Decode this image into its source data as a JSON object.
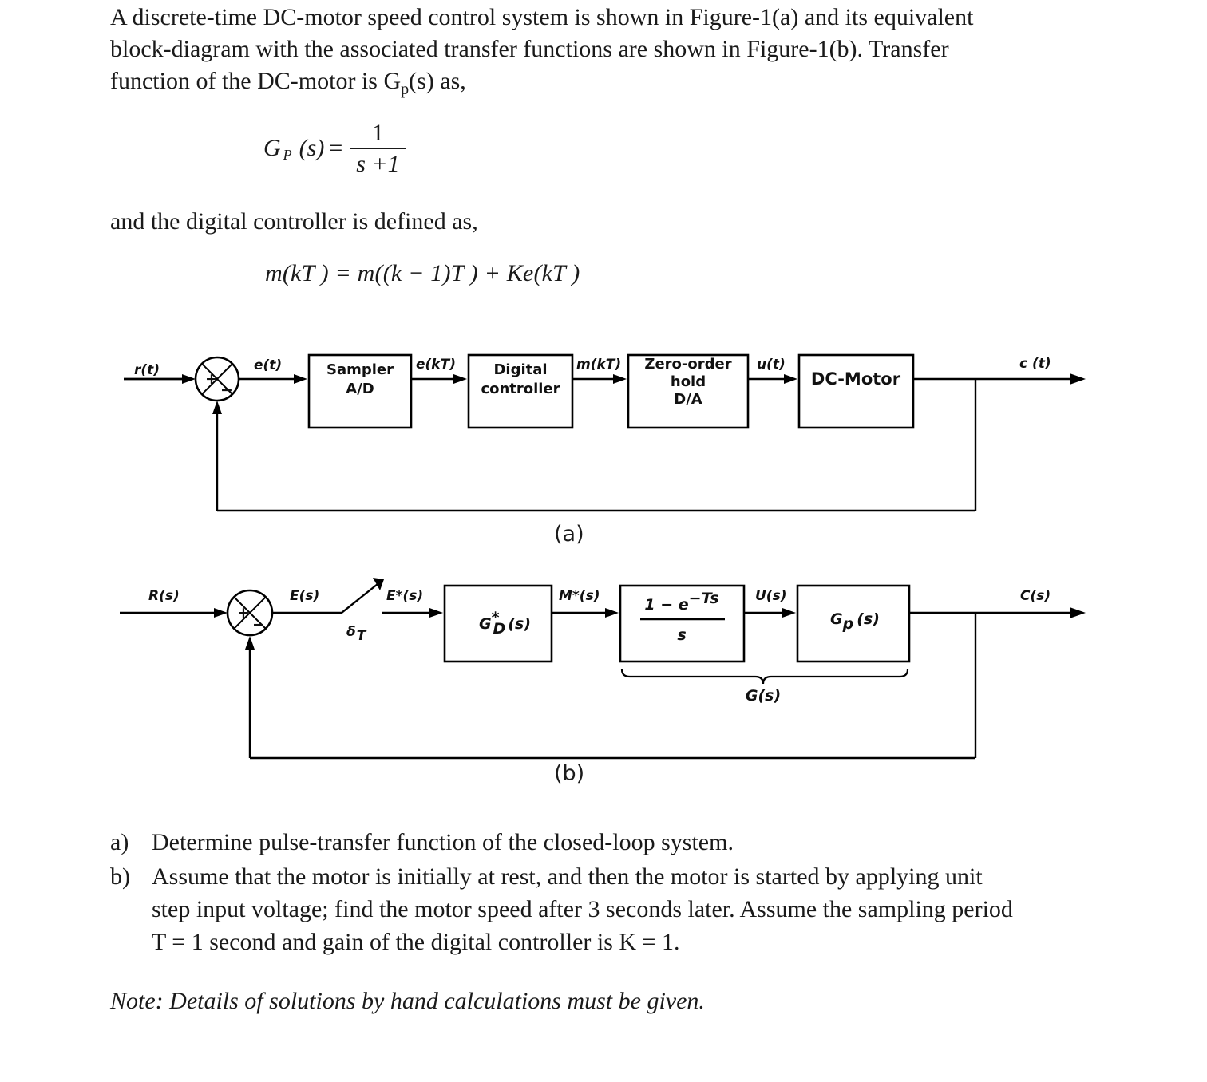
{
  "document": {
    "intro": {
      "line1_left": "A discrete-time DC-motor speed control system is shown in Figure-1(a) and its equivalent",
      "line2_left": "block-diagram with the associated transfer functions are shown in Figure-1(b). Transfer",
      "line3": "function of the DC-motor is G",
      "line3_sub": "p",
      "line3_rest": "(s) as,"
    },
    "equation_gp": {
      "lhs": "G",
      "lhs_sub": "P",
      "lhs_arg": "(s)",
      "equals": "=",
      "numerator": "1",
      "denominator": "s +1"
    },
    "controller_lead": "and the digital controller is defined as,",
    "equation_mkt": "m(kT ) = m((k − 1)T ) + Ke(kT )",
    "questions": [
      {
        "marker": "a)",
        "lines": [
          "Determine pulse-transfer function of the closed-loop system."
        ]
      },
      {
        "marker": "b)",
        "lines": [
          "Assume that the motor is initially at rest, and then the motor is started by applying unit",
          "step input voltage; find the motor speed after 3 seconds later. Assume the sampling period",
          "T = 1 second and gain of the digital controller is K = 1."
        ]
      }
    ],
    "note": "Note: Details of solutions by hand calculations must be given."
  },
  "figure_a": {
    "caption": "(a)",
    "input_label": "r(t)",
    "output_label": "c (t)",
    "summing_junction": {
      "plus": "+",
      "minus": "−"
    },
    "signals": [
      "e(t)",
      "e(kT)",
      "m(kT)",
      "u(t)"
    ],
    "blocks": [
      {
        "name": "sampler",
        "lines": [
          "Sampler",
          "A/D"
        ]
      },
      {
        "name": "digital-controller",
        "lines": [
          "Digital",
          "controller"
        ]
      },
      {
        "name": "zero-order-hold",
        "lines": [
          "Zero-order",
          "hold",
          "D/A"
        ]
      },
      {
        "name": "dc-motor",
        "lines": [
          "DC-Motor"
        ]
      }
    ]
  },
  "figure_b": {
    "caption": "(b)",
    "input_label": "R(s)",
    "output_label": "C(s)",
    "summing_junction": {
      "plus": "+",
      "minus": "−"
    },
    "sampler_label": "δ",
    "sampler_label_sub": "T",
    "signals": [
      "E(s)",
      "E*(s)",
      "M*(s)",
      "U(s)"
    ],
    "blocks": [
      {
        "name": "digital-controller-tf",
        "main": "G",
        "sub": "D",
        "sup": "*",
        "arg": "(s)"
      },
      {
        "name": "zero-order-hold-tf",
        "numerator": "1 − e",
        "numerator_exp": "−Ts",
        "denominator": "s"
      },
      {
        "name": "plant-tf",
        "main": "G",
        "sub": "p",
        "arg": "(s)"
      }
    ],
    "brace_label": "G(s)"
  }
}
